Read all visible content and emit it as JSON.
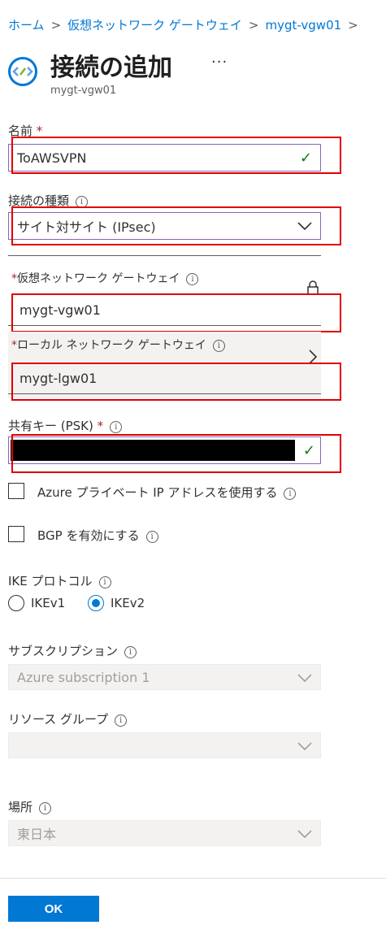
{
  "breadcrumb": {
    "items": [
      "ホーム",
      "仮想ネットワーク ゲートウェイ",
      "mygt-vgw01"
    ],
    "separator": ">"
  },
  "header": {
    "title": "接続の追加",
    "more": "···",
    "subtitle": "mygt-vgw01"
  },
  "fields": {
    "name": {
      "label": "名前",
      "required": "*",
      "value": "ToAWSVPN"
    },
    "connection_type": {
      "label": "接続の種類",
      "value": "サイト対サイト (IPsec)"
    },
    "vnet_gateway": {
      "required": "*",
      "label": "仮想ネットワーク ゲートウェイ",
      "value": "mygt-vgw01"
    },
    "local_gateway": {
      "required": "*",
      "label": "ローカル ネットワーク ゲートウェイ",
      "value": "mygt-lgw01"
    },
    "psk": {
      "label": "共有キー (PSK)",
      "required": "*",
      "value": ""
    },
    "azure_private_ip": {
      "label": "Azure プライベート IP アドレスを使用する",
      "checked": false
    },
    "bgp": {
      "label": "BGP を有効にする",
      "checked": false
    },
    "ike": {
      "label": "IKE プロトコル",
      "options": [
        "IKEv1",
        "IKEv2"
      ],
      "selected": "IKEv2"
    },
    "subscription": {
      "label": "サブスクリプション",
      "value": "Azure subscription 1"
    },
    "resource_group": {
      "label": "リソース グループ",
      "value": ""
    },
    "location": {
      "label": "場所",
      "value": "東日本"
    }
  },
  "info_glyph": "i",
  "footer": {
    "ok_label": "OK"
  },
  "colors": {
    "accent": "#0078d4",
    "highlight": "#e00000",
    "valid": "#107c10"
  }
}
